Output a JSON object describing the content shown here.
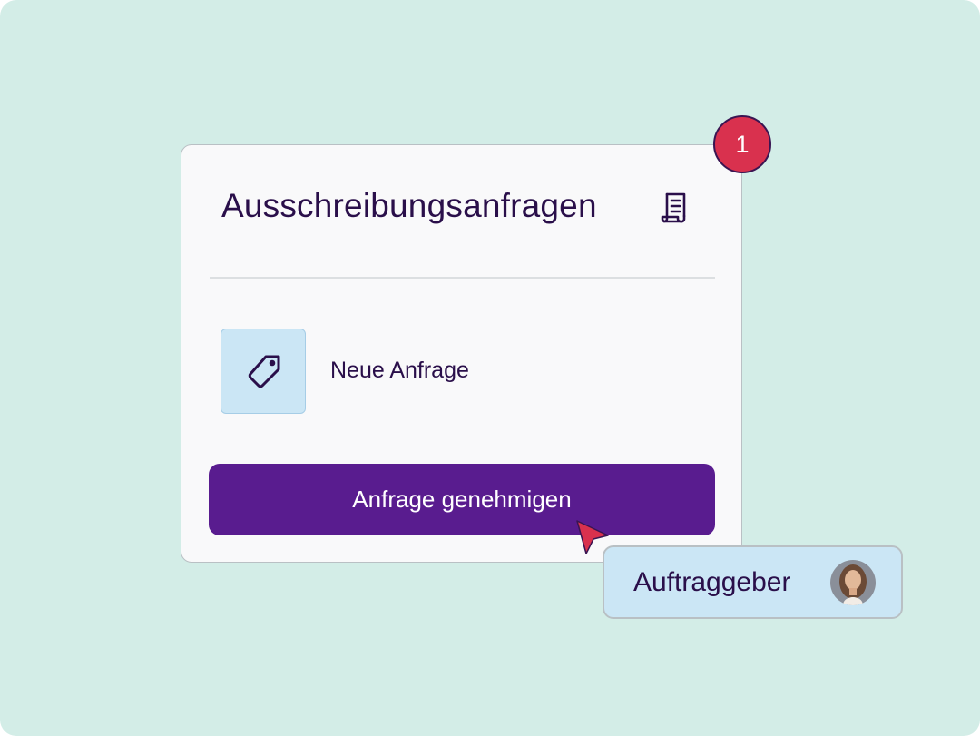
{
  "card": {
    "title": "Ausschreibungsanfragen",
    "title_icon": "document-icon",
    "item": {
      "icon": "tag-icon",
      "label": "Neue Anfrage"
    },
    "approve_button_label": "Anfrage genehmigen"
  },
  "notification_badge": {
    "count": "1"
  },
  "user_chip": {
    "label": "Auftraggeber",
    "avatar_icon": "avatar-photo"
  },
  "colors": {
    "background": "#d3ede7",
    "card": "#f9f9fa",
    "primary_button": "#591c8f",
    "badge": "#d9314e",
    "text": "#2a0f4a",
    "highlight": "#cbe6f5"
  }
}
